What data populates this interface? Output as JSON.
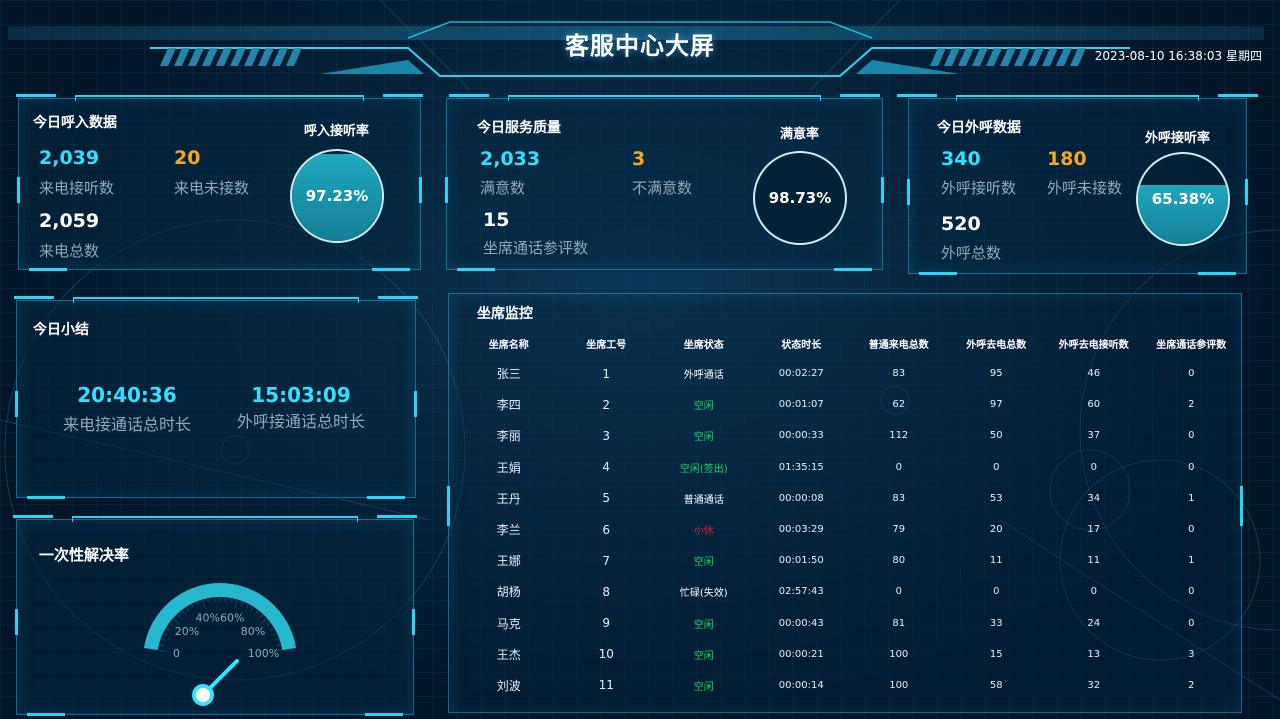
{
  "header": {
    "title": "客服中心大屏",
    "datetime": "2023-08-10 16:38:03 星期四"
  },
  "inbound": {
    "title": "今日呼入数据",
    "answered_value": "2,039",
    "answered_label": "来电接听数",
    "missed_value": "20",
    "missed_label": "来电未接数",
    "total_value": "2,059",
    "total_label": "来电总数",
    "rate_title": "呼入接听率",
    "rate_text": "97.23%",
    "rate_level": 0.9723
  },
  "quality": {
    "title": "今日服务质量",
    "satisfied_value": "2,033",
    "satisfied_label": "满意数",
    "unsatisfied_value": "3",
    "unsatisfied_label": "不满意数",
    "rated_value": "15",
    "rated_label": "坐席通话参评数",
    "rate_title": "满意率",
    "rate_text": "98.73%",
    "rate_level": 0.0
  },
  "outbound": {
    "title": "今日外呼数据",
    "answered_value": "340",
    "answered_label": "外呼接听数",
    "missed_value": "180",
    "missed_label": "外呼未接数",
    "total_value": "520",
    "total_label": "外呼总数",
    "rate_title": "外呼接听率",
    "rate_text": "65.38%",
    "rate_level": 0.6538
  },
  "summary": {
    "title": "今日小结",
    "inbound_time": "20:40:36",
    "inbound_label": "来电接通话总时长",
    "outbound_time": "15:03:09",
    "outbound_label": "外呼接通话总时长"
  },
  "resolution": {
    "title": "一次性解决率",
    "gauge_ticks": [
      "0",
      "20%",
      "40%",
      "60%",
      "80%",
      "100%"
    ],
    "gauge_value": 0.8
  },
  "monitor": {
    "title": "坐席监控",
    "columns": [
      "坐席名称",
      "坐席工号",
      "坐席状态",
      "状态时长",
      "普通来电总数",
      "外呼去电总数",
      "外呼去电接听数",
      "坐席通话参评数"
    ],
    "rows": [
      {
        "name": "张三",
        "id": "1",
        "status": "外呼通话",
        "status_type": "normal",
        "duration": "00:02:27",
        "in_total": "83",
        "out_total": "95",
        "out_answered": "46",
        "rated": "0"
      },
      {
        "name": "李四",
        "id": "2",
        "status": "空闲",
        "status_type": "idle",
        "duration": "00:01:07",
        "in_total": "62",
        "out_total": "97",
        "out_answered": "60",
        "rated": "2"
      },
      {
        "name": "李丽",
        "id": "3",
        "status": "空闲",
        "status_type": "idle",
        "duration": "00:00:33",
        "in_total": "112",
        "out_total": "50",
        "out_answered": "37",
        "rated": "0"
      },
      {
        "name": "王娟",
        "id": "4",
        "status": "空闲(签出)",
        "status_type": "idle",
        "duration": "01:35:15",
        "in_total": "0",
        "out_total": "0",
        "out_answered": "0",
        "rated": "0"
      },
      {
        "name": "王丹",
        "id": "5",
        "status": "普通通话",
        "status_type": "normal",
        "duration": "00:00:08",
        "in_total": "83",
        "out_total": "53",
        "out_answered": "34",
        "rated": "1"
      },
      {
        "name": "李兰",
        "id": "6",
        "status": "小休",
        "status_type": "rest",
        "duration": "00:03:29",
        "in_total": "79",
        "out_total": "20",
        "out_answered": "17",
        "rated": "0"
      },
      {
        "name": "王娜",
        "id": "7",
        "status": "空闲",
        "status_type": "idle",
        "duration": "00:01:50",
        "in_total": "80",
        "out_total": "11",
        "out_answered": "11",
        "rated": "1"
      },
      {
        "name": "胡杨",
        "id": "8",
        "status": "忙碌(失效)",
        "status_type": "normal",
        "duration": "02:57:43",
        "in_total": "0",
        "out_total": "0",
        "out_answered": "0",
        "rated": "0"
      },
      {
        "name": "马克",
        "id": "9",
        "status": "空闲",
        "status_type": "idle",
        "duration": "00:00:43",
        "in_total": "81",
        "out_total": "33",
        "out_answered": "24",
        "rated": "0"
      },
      {
        "name": "王杰",
        "id": "10",
        "status": "空闲",
        "status_type": "idle",
        "duration": "00:00:21",
        "in_total": "100",
        "out_total": "15",
        "out_answered": "13",
        "rated": "3"
      },
      {
        "name": "刘波",
        "id": "11",
        "status": "空闲",
        "status_type": "idle",
        "duration": "00:00:14",
        "in_total": "100",
        "out_total": "58",
        "out_answered": "32",
        "rated": "2"
      }
    ]
  },
  "colors": {
    "accent": "#2bd4f4",
    "highlight_number": "#2fe0ff",
    "warning_number": "#f5a623",
    "status_idle": "#1ed760",
    "status_rest": "#e0182d",
    "status_normal": "#ffffff"
  }
}
